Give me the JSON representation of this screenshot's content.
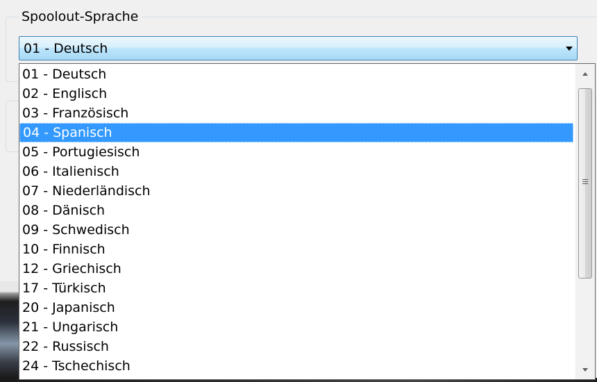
{
  "group": {
    "legend": "Spoolout-Sprache"
  },
  "combo": {
    "selected_value": "01 - Deutsch",
    "arrow_icon": "chevron-down-icon"
  },
  "list": {
    "items": [
      "01 - Deutsch",
      "02 - Englisch",
      "03 - Französisch",
      "04 - Spanisch",
      "05 - Portugiesisch",
      "06 - Italienisch",
      "07 - Niederländisch",
      "08 - Dänisch",
      "09 - Schwedisch",
      "10 - Finnisch",
      "12 - Griechisch",
      "17 - Türkisch",
      "20 - Japanisch",
      "21 - Ungarisch",
      "22 - Russisch",
      "24 - Tschechisch"
    ],
    "highlighted_index": 3
  },
  "colors": {
    "highlight": "#3399ff",
    "combo_border": "#3c7fb1"
  }
}
